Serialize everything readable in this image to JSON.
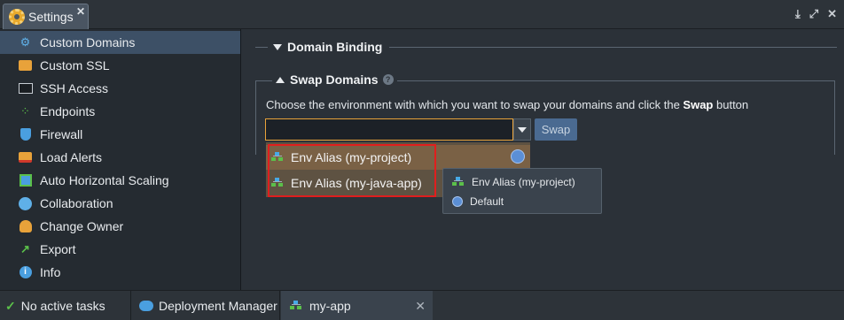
{
  "top_tab": {
    "title": "Settings",
    "close": "✕",
    "icon": "gear-icon"
  },
  "window_controls": [
    "download-icon",
    "expand-icon",
    "close-icon"
  ],
  "sidebar": {
    "items": [
      {
        "label": "Custom Domains",
        "icon": "domains-icon",
        "active": true
      },
      {
        "label": "Custom SSL",
        "icon": "ssl-icon"
      },
      {
        "label": "SSH Access",
        "icon": "terminal-icon"
      },
      {
        "label": "Endpoints",
        "icon": "endpoints-icon"
      },
      {
        "label": "Firewall",
        "icon": "shield-icon"
      },
      {
        "label": "Load Alerts",
        "icon": "alert-icon"
      },
      {
        "label": "Auto Horizontal Scaling",
        "icon": "scaling-icon"
      },
      {
        "label": "Collaboration",
        "icon": "handshake-icon"
      },
      {
        "label": "Change Owner",
        "icon": "owner-icon"
      },
      {
        "label": "Export",
        "icon": "export-icon"
      },
      {
        "label": "Info",
        "icon": "info-icon"
      }
    ]
  },
  "main": {
    "domain_binding": "Domain Binding",
    "swap_domains": "Swap Domains",
    "help": "?",
    "description_before": "Choose the environment with which you want to swap your domains and click the ",
    "description_bold": "Swap",
    "description_after": " button",
    "combo_value": "",
    "swap_button": "Swap",
    "dropdown": [
      {
        "label": "Env Alias (my-project)"
      },
      {
        "label": "Env Alias (my-java-app)"
      }
    ],
    "tooltip": [
      {
        "label": "Env Alias (my-project)",
        "icon": "env-icon"
      },
      {
        "label": "Default",
        "icon": "globe-icon"
      }
    ]
  },
  "bottom_bar": {
    "tasks": "No active tasks",
    "deployment_manager": "Deployment Manager",
    "app_tab": "my-app",
    "app_close": "✕"
  },
  "colors": {
    "accent_orange": "#e8a23a",
    "highlight_red": "#e01e1e",
    "active_blue": "#3d5066"
  }
}
